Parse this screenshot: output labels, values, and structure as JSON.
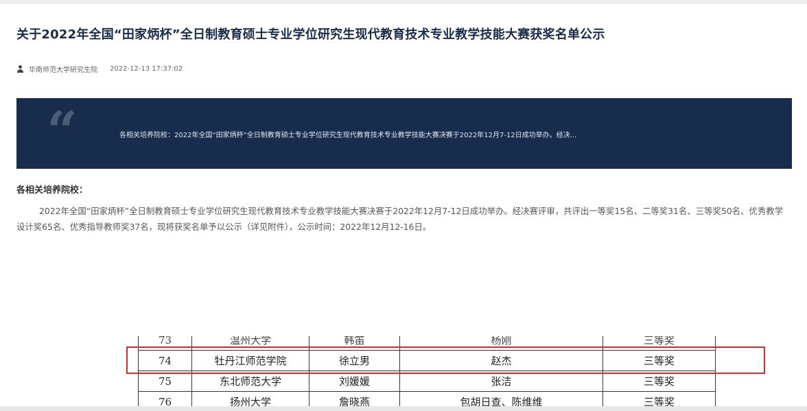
{
  "article": {
    "title": "关于2022年全国“田家炳杯”全日制教育硕士专业学位研究生现代教育技术专业教学技能大赛获奖名单公示",
    "author": "华南师范大学研究生院",
    "datetime": "2022-12-13 17:37:02",
    "summary": "各相关培养院校：2022年全国“田家炳杯”全日制教育硕士专业学位研究生现代教育技术专业教学技能大赛决赛于2022年12月7-12日成功举办。经决...",
    "quote_glyph": "“",
    "greeting": "各相关培养院校：",
    "body": "2022年全国“田家炳杯”全日制教育硕士专业学位研究生现代教育技术专业教学技能大赛决赛于2022年12月7-12日成功举办。经决赛评审，共评出一等奖15名、二等奖31名、三等奖50名、优秀教学设计奖65名、优秀指导教师奖37名，现将获奖名单予以公示（详见附件），公示时间：2022年12月12-16日。"
  },
  "award_table": {
    "rows": [
      {
        "no": "73",
        "school": "温州大学",
        "student": "韩笛",
        "advisor": "杨刚",
        "award": "三等奖"
      },
      {
        "no": "74",
        "school": "牡丹江师范学院",
        "student": "徐立男",
        "advisor": "赵杰",
        "award": "三等奖"
      },
      {
        "no": "75",
        "school": "东北师范大学",
        "student": "刘媛媛",
        "advisor": "张洁",
        "award": "三等奖"
      },
      {
        "no": "76",
        "school": "扬州大学",
        "student": "詹晓燕",
        "advisor": "包胡日查、陈维维",
        "award": "三等奖"
      }
    ],
    "highlight_color": "#d92b2b"
  },
  "colors": {
    "title": "#1a2b4a",
    "quote_bg": "#182c4e"
  }
}
